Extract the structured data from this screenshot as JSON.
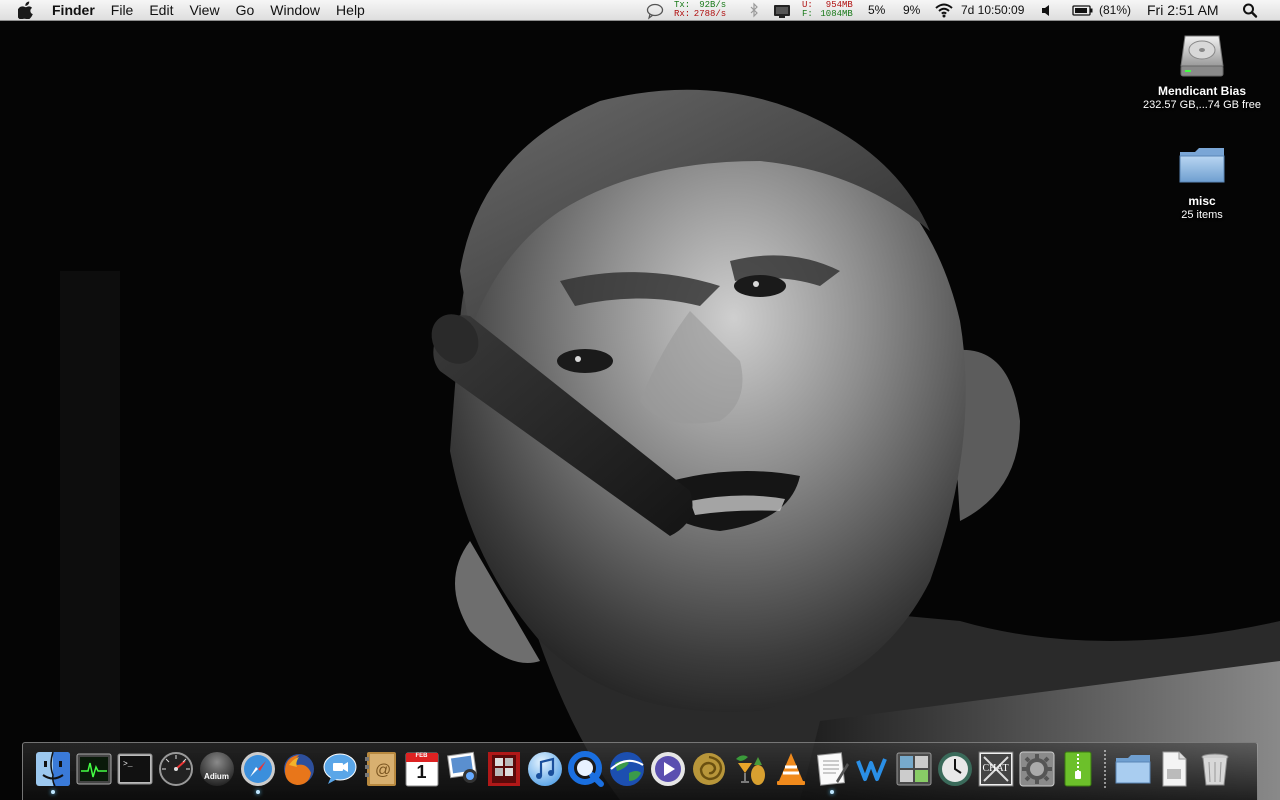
{
  "menubar": {
    "app_name": "Finder",
    "menus": [
      "File",
      "Edit",
      "View",
      "Go",
      "Window",
      "Help"
    ],
    "network": {
      "tx_label": "Tx:",
      "tx_value": "92B/s",
      "rx_label": "Rx:",
      "rx_value": "2788/s"
    },
    "memory": {
      "used_label": "U:",
      "used_value": "954MB",
      "free_label": "F:",
      "free_value": "1084MB"
    },
    "cpu_1": "5%",
    "cpu_2": "9%",
    "uptime": "7d 10:50:09",
    "battery": "(81%)",
    "clock": "Fri 2:51 AM"
  },
  "desktop": {
    "drive": {
      "name": "Mendicant Bias",
      "info": "232.57 GB,...74 GB free"
    },
    "folder": {
      "name": "misc",
      "info": "25 items"
    }
  },
  "dock": {
    "apps": [
      {
        "icon": "finder-icon",
        "running": true
      },
      {
        "icon": "activity-monitor-icon",
        "running": false
      },
      {
        "icon": "terminal-icon",
        "running": false
      },
      {
        "icon": "dashboard-icon",
        "running": false
      },
      {
        "icon": "adium-icon",
        "running": false,
        "label": "Adium"
      },
      {
        "icon": "safari-icon",
        "running": true
      },
      {
        "icon": "firefox-icon",
        "running": false
      },
      {
        "icon": "ichat-icon",
        "running": false
      },
      {
        "icon": "address-book-icon",
        "running": false
      },
      {
        "icon": "ical-icon",
        "running": false,
        "month": "FEB",
        "day": "1"
      },
      {
        "icon": "iphoto-icon",
        "running": false
      },
      {
        "icon": "photo-booth-icon",
        "running": false
      },
      {
        "icon": "itunes-icon",
        "running": false
      },
      {
        "icon": "quicktime-icon",
        "running": false
      },
      {
        "icon": "google-earth-icon",
        "running": false
      },
      {
        "icon": "front-row-icon",
        "running": false
      },
      {
        "icon": "shell-icon",
        "running": false
      },
      {
        "icon": "cocktail-icon",
        "running": false
      },
      {
        "icon": "vlc-icon",
        "running": false
      },
      {
        "icon": "textedit-icon",
        "running": true
      },
      {
        "icon": "wirelessdiagnostics-icon",
        "running": false
      },
      {
        "icon": "system-profiler-icon",
        "running": false
      },
      {
        "icon": "time-machine-icon",
        "running": false
      },
      {
        "icon": "chat-icon",
        "running": false,
        "label": "CHAT"
      },
      {
        "icon": "system-preferences-icon",
        "running": false
      },
      {
        "icon": "archive-utility-icon",
        "running": false
      }
    ],
    "stacks": [
      {
        "icon": "folder-icon"
      },
      {
        "icon": "documents-stack-icon"
      },
      {
        "icon": "trash-icon"
      }
    ]
  }
}
